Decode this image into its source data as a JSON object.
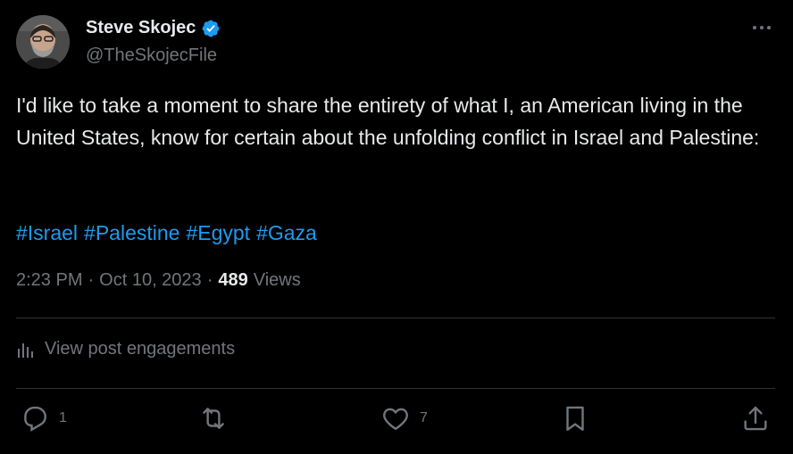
{
  "author": {
    "display_name": "Steve Skojec",
    "handle": "@TheSkojecFile",
    "verified": true
  },
  "post": {
    "text": "I'd like to take a moment to share the entirety of what I, an American living in the United States, know for certain about the unfolding conflict in Israel and Palestine:",
    "hashtags": [
      "#Israel",
      "#Palestine",
      "#Egypt",
      "#Gaza"
    ]
  },
  "meta": {
    "time": "2:23 PM",
    "separator": "·",
    "date": "Oct 10, 2023",
    "views_count": "489",
    "views_label": "Views"
  },
  "engagements": {
    "label": "View post engagements"
  },
  "actions": {
    "reply_count": "1",
    "like_count": "7"
  },
  "colors": {
    "accent": "#1d9bf0",
    "muted": "#71767b",
    "text": "#e7e9ea",
    "background": "#000000",
    "divider": "#2f3336"
  }
}
